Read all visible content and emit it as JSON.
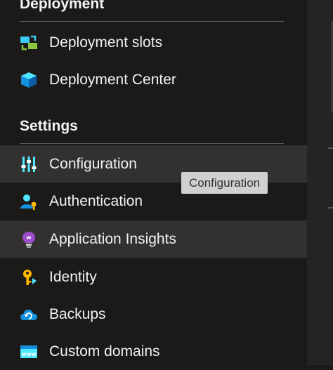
{
  "sections": {
    "deployment": {
      "title": "Deployment"
    },
    "settings": {
      "title": "Settings"
    }
  },
  "nav": {
    "deployment_slots": {
      "label": "Deployment slots",
      "icon": "deployment-slots-icon"
    },
    "deployment_center": {
      "label": "Deployment Center",
      "icon": "deployment-center-cube-icon"
    },
    "configuration": {
      "label": "Configuration",
      "icon": "configuration-sliders-icon"
    },
    "authentication": {
      "label": "Authentication",
      "icon": "authentication-user-key-icon"
    },
    "application_insights": {
      "label": "Application Insights",
      "icon": "lightbulb-icon"
    },
    "identity": {
      "label": "Identity",
      "icon": "identity-key-icon"
    },
    "backups": {
      "label": "Backups",
      "icon": "backup-cloud-icon"
    },
    "custom_domains": {
      "label": "Custom domains",
      "icon": "www-domain-icon"
    }
  },
  "tooltip": {
    "text": "Configuration"
  },
  "colors": {
    "background": "#1b1a19",
    "hover_row": "#323130",
    "text": "#f3f2f1",
    "tooltip_bg": "#d2d0ce",
    "divider": "#605e5c"
  }
}
